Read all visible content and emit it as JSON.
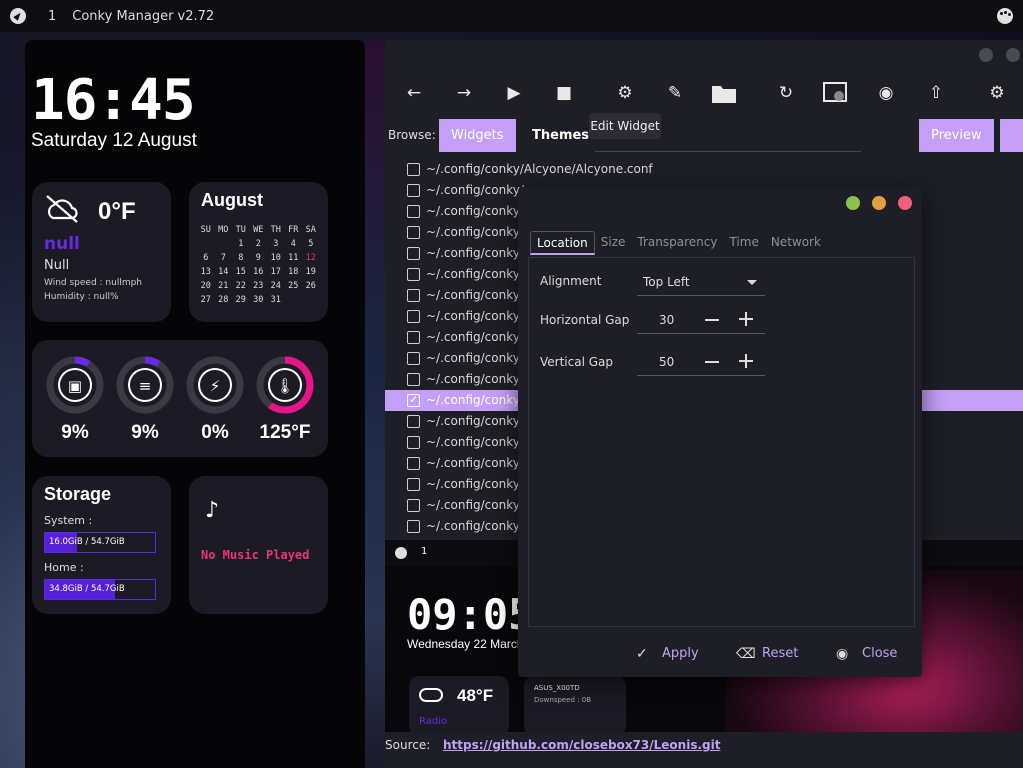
{
  "topbar": {
    "workspace": "1",
    "title": "Conky Manager v2.72"
  },
  "left_widget": {
    "time": "16:45",
    "date": "Saturday 12 August",
    "weather": {
      "temp": "0°F",
      "null1": "null",
      "null2": "Null",
      "wind": "Wind speed : nullmph",
      "humidity": "Humidity : null%"
    },
    "calendar": {
      "month": "August",
      "headers": [
        "SU",
        "MO",
        "TU",
        "WE",
        "TH",
        "FR",
        "SA"
      ],
      "days": [
        "",
        "",
        "1",
        "2",
        "3",
        "4",
        "5",
        "6",
        "7",
        "8",
        "9",
        "10",
        "11",
        "12",
        "13",
        "14",
        "15",
        "16",
        "17",
        "18",
        "19",
        "20",
        "21",
        "22",
        "23",
        "24",
        "25",
        "26",
        "27",
        "28",
        "29",
        "30",
        "31",
        "",
        ""
      ],
      "today": "12"
    },
    "system": [
      {
        "icon": "cpu-icon",
        "value": "9%",
        "percent": 9,
        "color": "#6a2ae0"
      },
      {
        "icon": "database-icon",
        "value": "9%",
        "percent": 9,
        "color": "#6a2ae0"
      },
      {
        "icon": "battery-charging-icon",
        "value": "0%",
        "percent": 0,
        "color": "#6a2ae0"
      },
      {
        "icon": "thermometer-icon",
        "value": "125°F",
        "percent": 60,
        "color": "#e8158a"
      }
    ],
    "storage": {
      "title": "Storage",
      "system_label": "System :",
      "system_value": "16.0GiB / 54.7GiB",
      "system_fraction": 0.29,
      "home_label": "Home :",
      "home_value": "34.8GiB / 54.7GiB",
      "home_fraction": 0.64
    },
    "music": {
      "status": "No Music Played"
    }
  },
  "main_window": {
    "browse_label": "Browse:",
    "tab_widgets": "Widgets",
    "tab_themes": "Themes",
    "preview_button": "Preview",
    "tooltip": "Edit Widget",
    "first_path": "~/.config/conky/Alcyone/Alcyone.conf",
    "row_prefix": "~/.config/conky/",
    "row_count": 18,
    "selected_row": 11,
    "source_label": "Source:",
    "source_link": "https://github.com/closebox73/Leonis.git",
    "preview": {
      "workspace": "1",
      "time": "09:05",
      "date": "Wednesday 22 March",
      "temp": "48°F",
      "radio": "Radio",
      "ssid": "ASUS_X00TD",
      "downspeed": "Downspeed : 0B"
    }
  },
  "dialog": {
    "tabs": [
      "Location",
      "Size",
      "Transparency",
      "Time",
      "Network"
    ],
    "active_tab": "Location",
    "alignment_label": "Alignment",
    "alignment_value": "Top Left",
    "hgap_label": "Horizontal Gap",
    "hgap_value": "30",
    "vgap_label": "Vertical Gap",
    "vgap_value": "50",
    "apply": "Apply",
    "reset": "Reset",
    "close": "Close",
    "colors": {
      "accent": "#c3a0f6",
      "green": "#8bc34a",
      "yellow": "#e0a040",
      "red": "#f0607a"
    }
  }
}
